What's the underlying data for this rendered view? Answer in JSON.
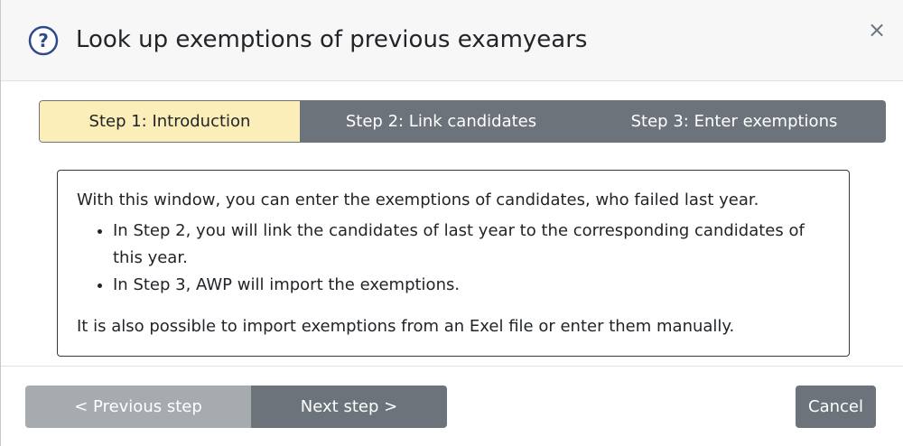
{
  "dialog": {
    "title": "Look up exemptions of previous examyears",
    "close_label": "×"
  },
  "steps": [
    {
      "label": "Step 1: Introduction",
      "active": true
    },
    {
      "label": "Step 2: Link candidates",
      "active": false
    },
    {
      "label": "Step 3: Enter exemptions",
      "active": false
    }
  ],
  "intro": {
    "lead": "With this window, you can enter the exemptions of candidates, who failed last year.",
    "bullets": [
      "In Step 2, you will link the candidates of last year to the corresponding candidates of this year.",
      "In Step 3, AWP will import the exemptions."
    ],
    "footer": "It is also possible to import exemptions from an Exel file or enter them manually."
  },
  "footer": {
    "prev_label": "< Previous step",
    "next_label": "Next step >",
    "cancel_label": "Cancel"
  },
  "icons": {
    "help": "question-circle-icon",
    "close": "close-icon"
  },
  "colors": {
    "active_step": "#fbeeb8",
    "inactive_step": "#6c737b",
    "disabled_button": "#a6abb0",
    "button": "#6c737b",
    "help_icon": "#2f4a8a"
  }
}
